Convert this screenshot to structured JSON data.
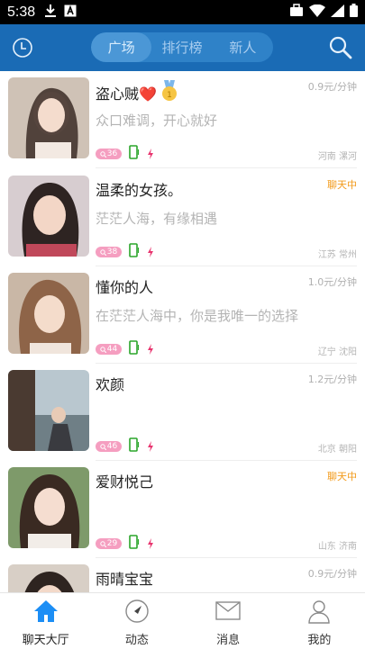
{
  "status_bar": {
    "time": "5:38"
  },
  "app_bar": {
    "tabs": [
      {
        "label": "广场",
        "active": true
      },
      {
        "label": "排行榜",
        "active": false
      },
      {
        "label": "新人",
        "active": false
      }
    ]
  },
  "users": [
    {
      "name": "盗心贼❤️",
      "signature": "众口难调，开心就好",
      "price": "0.9元/分钟",
      "age": "36",
      "location": "河南 漯河",
      "rank_badge": "1",
      "photo_icon": "user-photo"
    },
    {
      "name": "温柔的女孩。",
      "signature": "茫茫人海，有缘相遇",
      "price": "聊天中",
      "age": "38",
      "location": "江苏 常州",
      "photo_icon": "user-photo"
    },
    {
      "name": "懂你的人",
      "signature": "在茫茫人海中，你是我唯一的选择",
      "price": "1.0元/分钟",
      "age": "44",
      "location": "辽宁 沈阳",
      "photo_icon": "user-photo"
    },
    {
      "name": "欢颜",
      "signature": "",
      "price": "1.2元/分钟",
      "age": "46",
      "location": "北京 朝阳",
      "photo_icon": "user-photo"
    },
    {
      "name": "爱财悦己",
      "signature": "",
      "price": "聊天中",
      "age": "29",
      "location": "山东 济南",
      "photo_icon": "user-photo"
    },
    {
      "name": "雨晴宝宝",
      "signature": "",
      "price": "0.9元/分钟",
      "age": "",
      "location": "",
      "photo_icon": "user-photo"
    }
  ],
  "bottom_nav": [
    {
      "label": "聊天大厅",
      "icon": "home-icon",
      "active": true
    },
    {
      "label": "动态",
      "icon": "compass-icon",
      "active": false
    },
    {
      "label": "消息",
      "icon": "mail-icon",
      "active": false
    },
    {
      "label": "我的",
      "icon": "person-icon",
      "active": false
    }
  ],
  "colors": {
    "app_bar": "#1a6bb5",
    "accent_blue": "#1c8ef5",
    "chatting_orange": "#f29a1a",
    "age_pink": "#f59ec0"
  }
}
